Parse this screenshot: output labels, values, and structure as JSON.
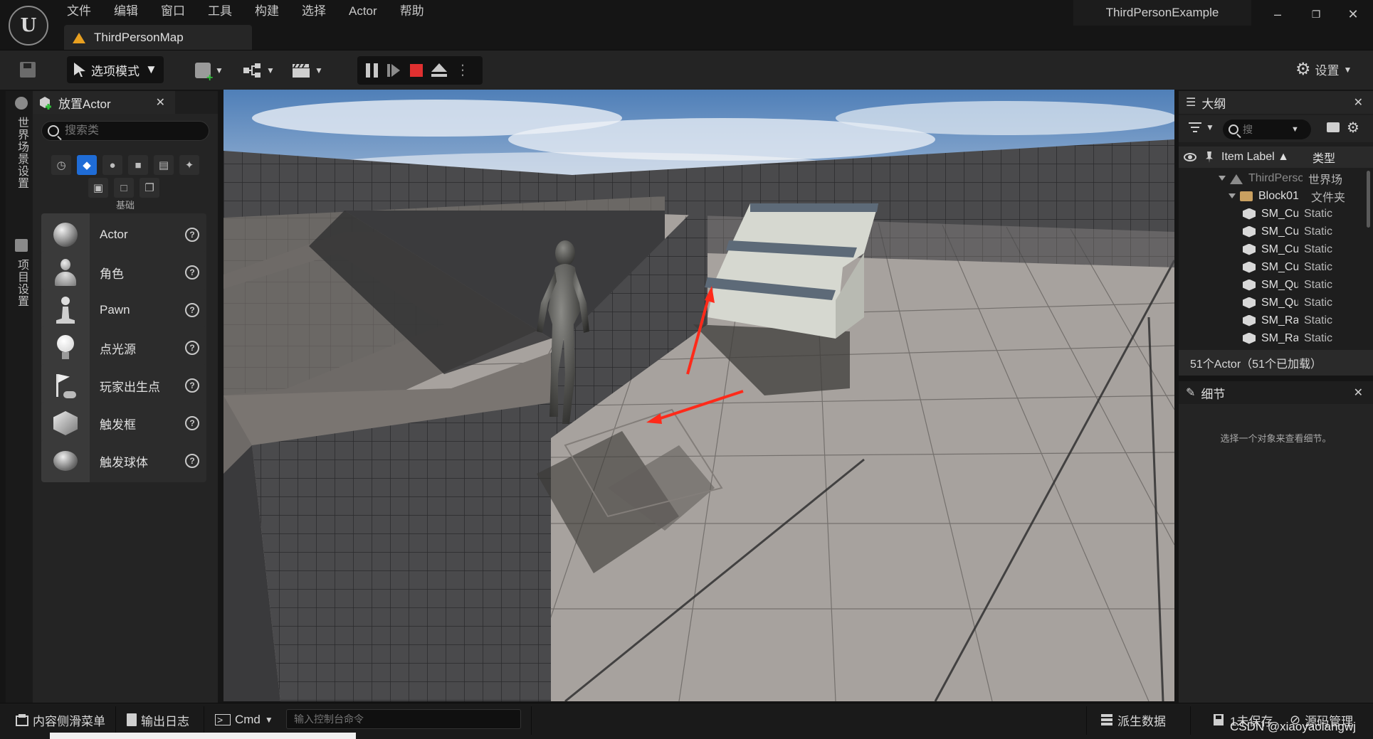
{
  "app": {
    "project_name": "ThirdPersonExample",
    "map_tab": "ThirdPersonMap"
  },
  "menu": [
    "文件",
    "编辑",
    "窗口",
    "工具",
    "构建",
    "选择",
    "Actor",
    "帮助"
  ],
  "toolbar": {
    "mode_label": "选项模式",
    "settings_label": "设置"
  },
  "left_strip": {
    "world_settings": "世界场景设置",
    "project_settings": "项目设置"
  },
  "place_actors": {
    "tab_title": "放置Actor",
    "search_placeholder": "搜索类",
    "category_label": "基础",
    "items": [
      {
        "label": "Actor",
        "icon": "sphere-icon"
      },
      {
        "label": "角色",
        "icon": "character-icon"
      },
      {
        "label": "Pawn",
        "icon": "pawn-icon"
      },
      {
        "label": "点光源",
        "icon": "point-light-icon"
      },
      {
        "label": "玩家出生点",
        "icon": "player-start-icon"
      },
      {
        "label": "触发框",
        "icon": "trigger-box-icon"
      },
      {
        "label": "触发球体",
        "icon": "trigger-sphere-icon"
      }
    ]
  },
  "outliner": {
    "tab_title": "大纲",
    "search_placeholder": "搜",
    "col_label": "Item Label ▲",
    "col_type": "类型",
    "rows": [
      {
        "name": "ThirdPerso",
        "type": "世界场",
        "kind": "world"
      },
      {
        "name": "Block01",
        "type": "文件夹",
        "kind": "folder"
      },
      {
        "name": "SM_Cu",
        "type": "Static",
        "kind": "mesh"
      },
      {
        "name": "SM_Cu",
        "type": "Static",
        "kind": "mesh"
      },
      {
        "name": "SM_Cu",
        "type": "Static",
        "kind": "mesh"
      },
      {
        "name": "SM_Cu",
        "type": "Static",
        "kind": "mesh"
      },
      {
        "name": "SM_Qu",
        "type": "Static",
        "kind": "mesh"
      },
      {
        "name": "SM_Qu",
        "type": "Static",
        "kind": "mesh"
      },
      {
        "name": "SM_Ra",
        "type": "Static",
        "kind": "mesh"
      },
      {
        "name": "SM_Ra",
        "type": "Static",
        "kind": "mesh"
      }
    ],
    "footer": "51个Actor（51个已加载）"
  },
  "details": {
    "tab_title": "细节",
    "empty_text": "选择一个对象来查看细节。"
  },
  "statusbar": {
    "content_drawer": "内容侧滑菜单",
    "output_log": "输出日志",
    "cmd_label": "Cmd",
    "cmd_placeholder": "输入控制台命令",
    "derived_data": "派生数据",
    "unsaved": "1未保存",
    "source_control": "源码管理",
    "watermark": "CSDN @xiaoyaolangwj"
  },
  "colors": {
    "accent_blue": "#1f6cd6",
    "stop_red": "#e03030",
    "arrow_red": "#ff2a1a",
    "warning_orange": "#e8a020"
  }
}
